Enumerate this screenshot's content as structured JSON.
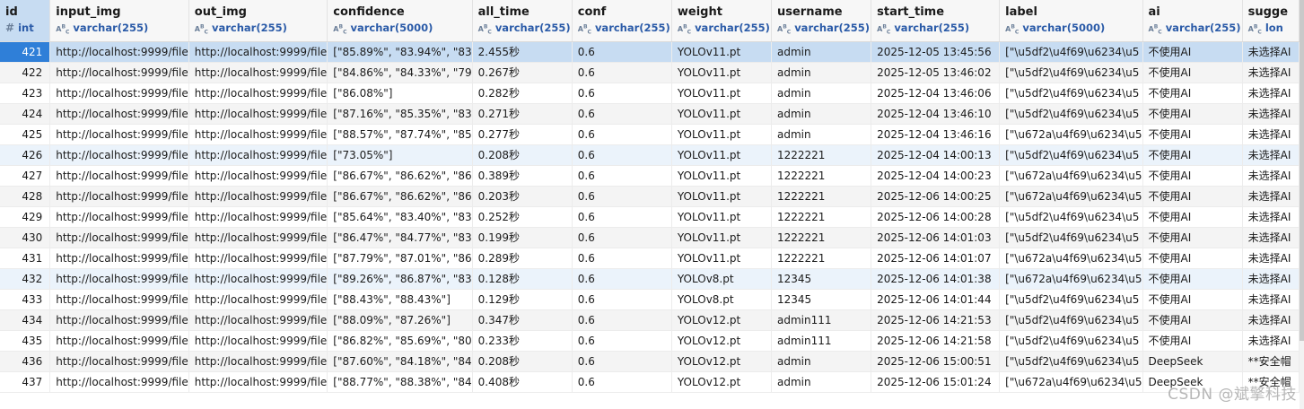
{
  "columns": [
    {
      "name": "id",
      "type": "int",
      "icon": "hash-icon"
    },
    {
      "name": "input_img",
      "type": "varchar(255)",
      "icon": "text-type-icon"
    },
    {
      "name": "out_img",
      "type": "varchar(255)",
      "icon": "text-type-icon"
    },
    {
      "name": "confidence",
      "type": "varchar(5000)",
      "icon": "text-type-icon"
    },
    {
      "name": "all_time",
      "type": "varchar(255)",
      "icon": "text-type-icon"
    },
    {
      "name": "conf",
      "type": "varchar(255)",
      "icon": "text-type-icon"
    },
    {
      "name": "weight",
      "type": "varchar(255)",
      "icon": "text-type-icon"
    },
    {
      "name": "username",
      "type": "varchar(255)",
      "icon": "text-type-icon"
    },
    {
      "name": "start_time",
      "type": "varchar(255)",
      "icon": "text-type-icon"
    },
    {
      "name": "label",
      "type": "varchar(5000)",
      "icon": "text-type-icon"
    },
    {
      "name": "ai",
      "type": "varchar(255)",
      "icon": "text-type-icon"
    },
    {
      "name": "sugge",
      "type": "lon",
      "icon": "text-type-icon"
    }
  ],
  "rows": [
    [
      "421",
      "http://localhost:9999/file",
      "http://localhost:9999/file",
      "[\"85.89%\", \"83.94%\", \"83",
      "2.455秒",
      "0.6",
      "YOLOv11.pt",
      "admin",
      "2025-12-05 13:45:56",
      "[\"\\u5df2\\u4f69\\u6234\\u5",
      "不使用AI",
      "未选择AI"
    ],
    [
      "422",
      "http://localhost:9999/file",
      "http://localhost:9999/file",
      "[\"84.86%\", \"84.33%\", \"79",
      "0.267秒",
      "0.6",
      "YOLOv11.pt",
      "admin",
      "2025-12-05 13:46:02",
      "[\"\\u5df2\\u4f69\\u6234\\u5",
      "不使用AI",
      "未选择AI"
    ],
    [
      "423",
      "http://localhost:9999/file",
      "http://localhost:9999/file",
      "[\"86.08%\"]",
      "0.282秒",
      "0.6",
      "YOLOv11.pt",
      "admin",
      "2025-12-04 13:46:06",
      "[\"\\u5df2\\u4f69\\u6234\\u5",
      "不使用AI",
      "未选择AI"
    ],
    [
      "424",
      "http://localhost:9999/file",
      "http://localhost:9999/file",
      "[\"87.16%\", \"85.35%\", \"83",
      "0.271秒",
      "0.6",
      "YOLOv11.pt",
      "admin",
      "2025-12-04 13:46:10",
      "[\"\\u5df2\\u4f69\\u6234\\u5",
      "不使用AI",
      "未选择AI"
    ],
    [
      "425",
      "http://localhost:9999/file",
      "http://localhost:9999/file",
      "[\"88.57%\", \"87.74%\", \"85",
      "0.277秒",
      "0.6",
      "YOLOv11.pt",
      "admin",
      "2025-12-04 13:46:16",
      "[\"\\u672a\\u4f69\\u6234\\u5",
      "不使用AI",
      "未选择AI"
    ],
    [
      "426",
      "http://localhost:9999/file",
      "http://localhost:9999/file",
      "[\"73.05%\"]",
      "0.208秒",
      "0.6",
      "YOLOv11.pt",
      "1222221",
      "2025-12-04 14:00:13",
      "[\"\\u5df2\\u4f69\\u6234\\u5",
      "不使用AI",
      "未选择AI"
    ],
    [
      "427",
      "http://localhost:9999/file",
      "http://localhost:9999/file",
      "[\"86.67%\", \"86.62%\", \"86",
      "0.389秒",
      "0.6",
      "YOLOv11.pt",
      "1222221",
      "2025-12-04 14:00:23",
      "[\"\\u672a\\u4f69\\u6234\\u5",
      "不使用AI",
      "未选择AI"
    ],
    [
      "428",
      "http://localhost:9999/file",
      "http://localhost:9999/file",
      "[\"86.67%\", \"86.62%\", \"86",
      "0.203秒",
      "0.6",
      "YOLOv11.pt",
      "1222221",
      "2025-12-06 14:00:25",
      "[\"\\u672a\\u4f69\\u6234\\u5",
      "不使用AI",
      "未选择AI"
    ],
    [
      "429",
      "http://localhost:9999/file",
      "http://localhost:9999/file",
      "[\"85.64%\", \"83.40%\", \"83",
      "0.252秒",
      "0.6",
      "YOLOv11.pt",
      "1222221",
      "2025-12-06 14:00:28",
      "[\"\\u5df2\\u4f69\\u6234\\u5",
      "不使用AI",
      "未选择AI"
    ],
    [
      "430",
      "http://localhost:9999/file",
      "http://localhost:9999/file",
      "[\"86.47%\", \"84.77%\", \"83",
      "0.199秒",
      "0.6",
      "YOLOv11.pt",
      "1222221",
      "2025-12-06 14:01:03",
      "[\"\\u5df2\\u4f69\\u6234\\u5",
      "不使用AI",
      "未选择AI"
    ],
    [
      "431",
      "http://localhost:9999/file",
      "http://localhost:9999/file",
      "[\"87.79%\", \"87.01%\", \"86",
      "0.289秒",
      "0.6",
      "YOLOv11.pt",
      "1222221",
      "2025-12-06 14:01:07",
      "[\"\\u672a\\u4f69\\u6234\\u5",
      "不使用AI",
      "未选择AI"
    ],
    [
      "432",
      "http://localhost:9999/file",
      "http://localhost:9999/file",
      "[\"89.26%\", \"86.87%\", \"83",
      "0.128秒",
      "0.6",
      "YOLOv8.pt",
      "12345",
      "2025-12-06 14:01:38",
      "[\"\\u672a\\u4f69\\u6234\\u5",
      "不使用AI",
      "未选择AI"
    ],
    [
      "433",
      "http://localhost:9999/file",
      "http://localhost:9999/file",
      "[\"88.43%\", \"88.43%\"]",
      "0.129秒",
      "0.6",
      "YOLOv8.pt",
      "12345",
      "2025-12-06 14:01:44",
      "[\"\\u5df2\\u4f69\\u6234\\u5",
      "不使用AI",
      "未选择AI"
    ],
    [
      "434",
      "http://localhost:9999/file",
      "http://localhost:9999/file",
      "[\"88.09%\", \"87.26%\"]",
      "0.347秒",
      "0.6",
      "YOLOv12.pt",
      "admin111",
      "2025-12-06 14:21:53",
      "[\"\\u5df2\\u4f69\\u6234\\u5",
      "不使用AI",
      "未选择AI"
    ],
    [
      "435",
      "http://localhost:9999/file",
      "http://localhost:9999/file",
      "[\"86.82%\", \"85.69%\", \"80",
      "0.233秒",
      "0.6",
      "YOLOv12.pt",
      "admin111",
      "2025-12-06 14:21:58",
      "[\"\\u5df2\\u4f69\\u6234\\u5",
      "不使用AI",
      "未选择AI"
    ],
    [
      "436",
      "http://localhost:9999/file",
      "http://localhost:9999/file",
      "[\"87.60%\", \"84.18%\", \"84",
      "0.208秒",
      "0.6",
      "YOLOv12.pt",
      "admin",
      "2025-12-06 15:00:51",
      "[\"\\u5df2\\u4f69\\u6234\\u5",
      "DeepSeek",
      "**安全帽"
    ],
    [
      "437",
      "http://localhost:9999/file",
      "http://localhost:9999/file",
      "[\"88.77%\", \"88.38%\", \"84",
      "0.408秒",
      "0.6",
      "YOLOv12.pt",
      "admin",
      "2025-12-06 15:01:24",
      "[\"\\u672a\\u4f69\\u6234\\u5",
      "DeepSeek",
      "**安全帽"
    ]
  ],
  "selected_row": 0,
  "highlight_rows": [
    5,
    11
  ],
  "watermark": "CSDN @斌擎科技",
  "colors": {
    "selected_row": "#c7dcf2",
    "selected_cell": "#2f7fd8",
    "type_text": "#2b5ba8",
    "alt_row": "#f4f4f4"
  }
}
